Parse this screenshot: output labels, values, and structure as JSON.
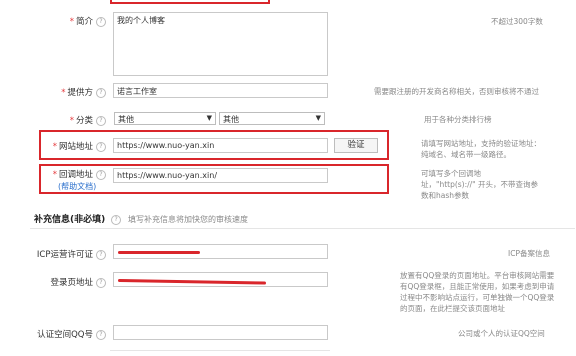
{
  "fields": {
    "intro": {
      "label": "简介",
      "value": "我的个人博客",
      "hint": "不超过300字数"
    },
    "provider": {
      "label": "提供方",
      "value": "诺言工作室",
      "hint": "需要跟注册的开发商名称相关，否则审核将不通过"
    },
    "category": {
      "label": "分类",
      "select1": "其他",
      "select2": "其他",
      "hint": "用于各种分类排行榜"
    },
    "site_url": {
      "label": "网站地址",
      "value": "https://www.nuo-yan.xin",
      "button": "验证",
      "hint": [
        "请填写网站地址，支持的验证地址：",
        "纯域名、域名带一级路径。"
      ]
    },
    "callback": {
      "label": "回调地址",
      "help": "(帮助文档)",
      "value": "https://www.nuo-yan.xin/",
      "hint": [
        "可填写多个回调地",
        "址，\"http(s)://\" 开头，不带查询参",
        "数和hash参数"
      ]
    }
  },
  "supplement": {
    "title": "补充信息(非必填)",
    "subtitle": "填写补充信息将加快您的审核速度"
  },
  "extra": {
    "icp": {
      "label": "ICP运营许可证",
      "hint": "ICP备案信息"
    },
    "login": {
      "label": "登录页地址",
      "hint": [
        "放置有QQ登录的页面地址。平台审核网站需要",
        "有QQ登录框，且能正常使用，如果考虑到申请",
        "过程中不影响站点运行，可单独做一个QQ登录",
        "的页面，在此栏提交该页面地址"
      ]
    },
    "qq": {
      "label": "认证空间QQ号",
      "hint": "公司或个人的认证QQ空间"
    }
  },
  "colors": {
    "highlight": "#d9262b",
    "required": "#e4393c",
    "link": "#2a6fcc"
  }
}
